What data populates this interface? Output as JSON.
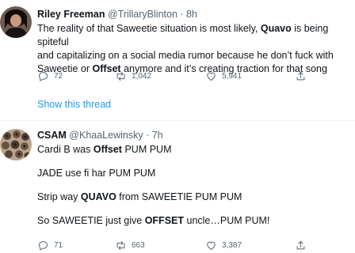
{
  "tweet1": {
    "name": "Riley Freeman",
    "handle": "@TrillaryBlinton",
    "time": "8h",
    "body": [
      [
        {
          "t": "The reality of that Saweetie situation is most likely, "
        },
        {
          "t": "Quavo",
          "b": true
        },
        {
          "t": " is being spiteful"
        }
      ],
      [
        {
          "t": "and capitalizing on a social media rumor because he don’t fuck with"
        }
      ],
      [
        {
          "t": "Saweetie or "
        },
        {
          "t": "Offset",
          "b": true
        },
        {
          "t": " anymore and it’s creating traction for that song"
        }
      ]
    ],
    "replies": "72",
    "retweets": "1,042",
    "likes": "5,941",
    "show_thread": "Show this thread"
  },
  "tweet2": {
    "name": "CSAM",
    "handle": "@KhaaLewinsky",
    "time": "7h",
    "body": [
      [
        {
          "t": "Cardi B was "
        },
        {
          "t": "Offset",
          "b": true
        },
        {
          "t": " PUM PUM"
        }
      ],
      [
        {
          "t": "JADE use fi har PUM PUM"
        }
      ],
      [
        {
          "t": "Strip way "
        },
        {
          "t": "QUAVO",
          "b": true
        },
        {
          "t": " from SAWEETIE PUM PUM"
        }
      ],
      [
        {
          "t": "So SAWEETIE just give "
        },
        {
          "t": "OFFSET",
          "b": true
        },
        {
          "t": " uncle…PUM PUM!"
        }
      ]
    ],
    "replies": "71",
    "retweets": "663",
    "likes": "3,387"
  }
}
